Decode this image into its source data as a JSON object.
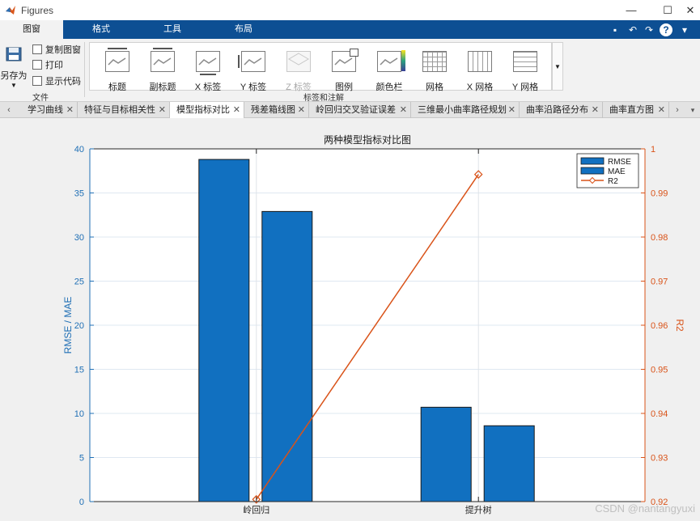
{
  "window": {
    "title": "Figures"
  },
  "ribbon_tabs": [
    {
      "label": "图窗",
      "active": true
    },
    {
      "label": "格式",
      "active": false
    },
    {
      "label": "工具",
      "active": false
    },
    {
      "label": "布局",
      "active": false
    }
  ],
  "file_group": {
    "save_as_label": "另存为",
    "copy_label": "复制图窗",
    "print_label": "打印",
    "show_code_label": "显示代码",
    "show_code_checked": false,
    "group_title": "文件"
  },
  "annot_group": {
    "items": [
      {
        "label": "标题",
        "icon": "title-icon",
        "enabled": true
      },
      {
        "label": "副标题",
        "icon": "subtitle-icon",
        "enabled": true
      },
      {
        "label": "X 标签",
        "icon": "xlabel-icon",
        "enabled": true
      },
      {
        "label": "Y 标签",
        "icon": "ylabel-icon",
        "enabled": true
      },
      {
        "label": "Z 标签",
        "icon": "zlabel-icon",
        "enabled": false
      },
      {
        "label": "图例",
        "icon": "legend-icon",
        "enabled": true
      },
      {
        "label": "颜色栏",
        "icon": "colorbar-icon",
        "enabled": true
      },
      {
        "label": "网格",
        "icon": "grid-icon",
        "enabled": true
      },
      {
        "label": "X 网格",
        "icon": "xgrid-icon",
        "enabled": true
      },
      {
        "label": "Y 网格",
        "icon": "ygrid-icon",
        "enabled": true
      }
    ],
    "group_title": "标签和注解"
  },
  "doc_tabs": [
    {
      "label": "学习曲线",
      "active": false
    },
    {
      "label": "特征与目标相关性",
      "active": false
    },
    {
      "label": "模型指标对比",
      "active": true
    },
    {
      "label": "残差箱线图",
      "active": false
    },
    {
      "label": "岭回归交叉验证误差",
      "active": false
    },
    {
      "label": "三维最小曲率路径规划",
      "active": false
    },
    {
      "label": "曲率沿路径分布",
      "active": false
    },
    {
      "label": "曲率直方图",
      "active": false
    }
  ],
  "colors": {
    "bar": "#1170c0",
    "line": "#d95319",
    "left_axis": "#1f6fb5",
    "right_axis": "#d95319",
    "ribbon_blue": "#0d4f93"
  },
  "chart_data": {
    "type": "bar",
    "title": "两种模型指标对比图",
    "categories": [
      "岭回归",
      "提升树"
    ],
    "ylabel": "RMSE / MAE",
    "ylabel_right": "R2",
    "ylim": [
      0,
      40
    ],
    "ylim_right": [
      0.92,
      1
    ],
    "yticks": [
      "0",
      "5",
      "10",
      "15",
      "20",
      "25",
      "30",
      "35",
      "40"
    ],
    "yticks_right": [
      "0.92",
      "0.93",
      "0.94",
      "0.95",
      "0.96",
      "0.97",
      "0.98",
      "0.99",
      "1"
    ],
    "grid": true,
    "legend_position": "top-right",
    "series": [
      {
        "name": "RMSE",
        "kind": "bar",
        "axis": "left",
        "values": [
          38.8,
          10.7
        ]
      },
      {
        "name": "MAE",
        "kind": "bar",
        "axis": "left",
        "values": [
          32.9,
          8.6
        ]
      },
      {
        "name": "R2",
        "kind": "line",
        "axis": "right",
        "marker": "diamond",
        "values": [
          0.9205,
          0.9942
        ]
      }
    ]
  },
  "watermark": "CSDN @nantangyuxi"
}
